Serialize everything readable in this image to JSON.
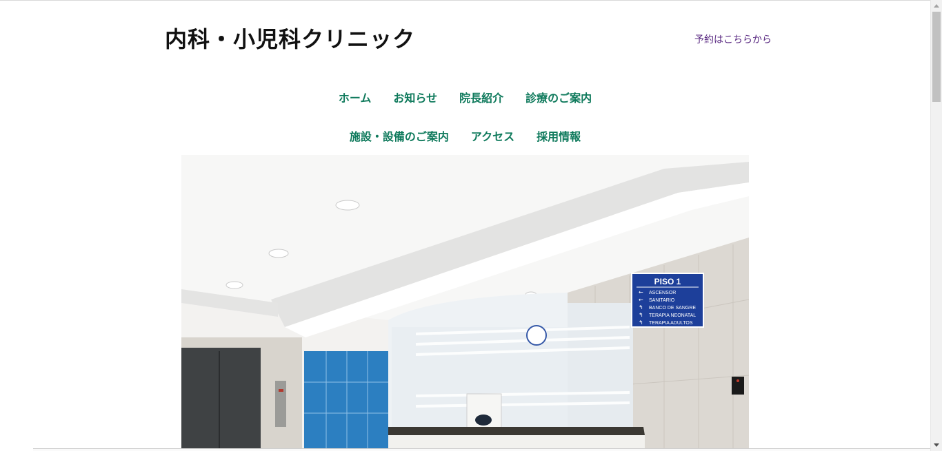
{
  "header": {
    "site_title": "内科・小児科クリニック",
    "reserve_link": "予約はこちらから"
  },
  "nav": {
    "row1": [
      {
        "label": "ホーム"
      },
      {
        "label": "お知らせ"
      },
      {
        "label": "院長紹介"
      },
      {
        "label": "診療のご案内"
      }
    ],
    "row2": [
      {
        "label": "施設・設備のご案内"
      },
      {
        "label": "アクセス"
      },
      {
        "label": "採用情報"
      }
    ]
  },
  "hero": {
    "sign": {
      "title": "PISO 1",
      "items": [
        "ASCENSOR",
        "SANITARIO",
        "BANCO DE SANGRE",
        "TERAPIA NEONATAL",
        "TERAPIA ADULTOS"
      ]
    }
  },
  "colors": {
    "nav_link": "#0f7a5c",
    "reserve_link": "#5a2a82",
    "title": "#111111",
    "sign_blue": "#1d3f9a"
  }
}
